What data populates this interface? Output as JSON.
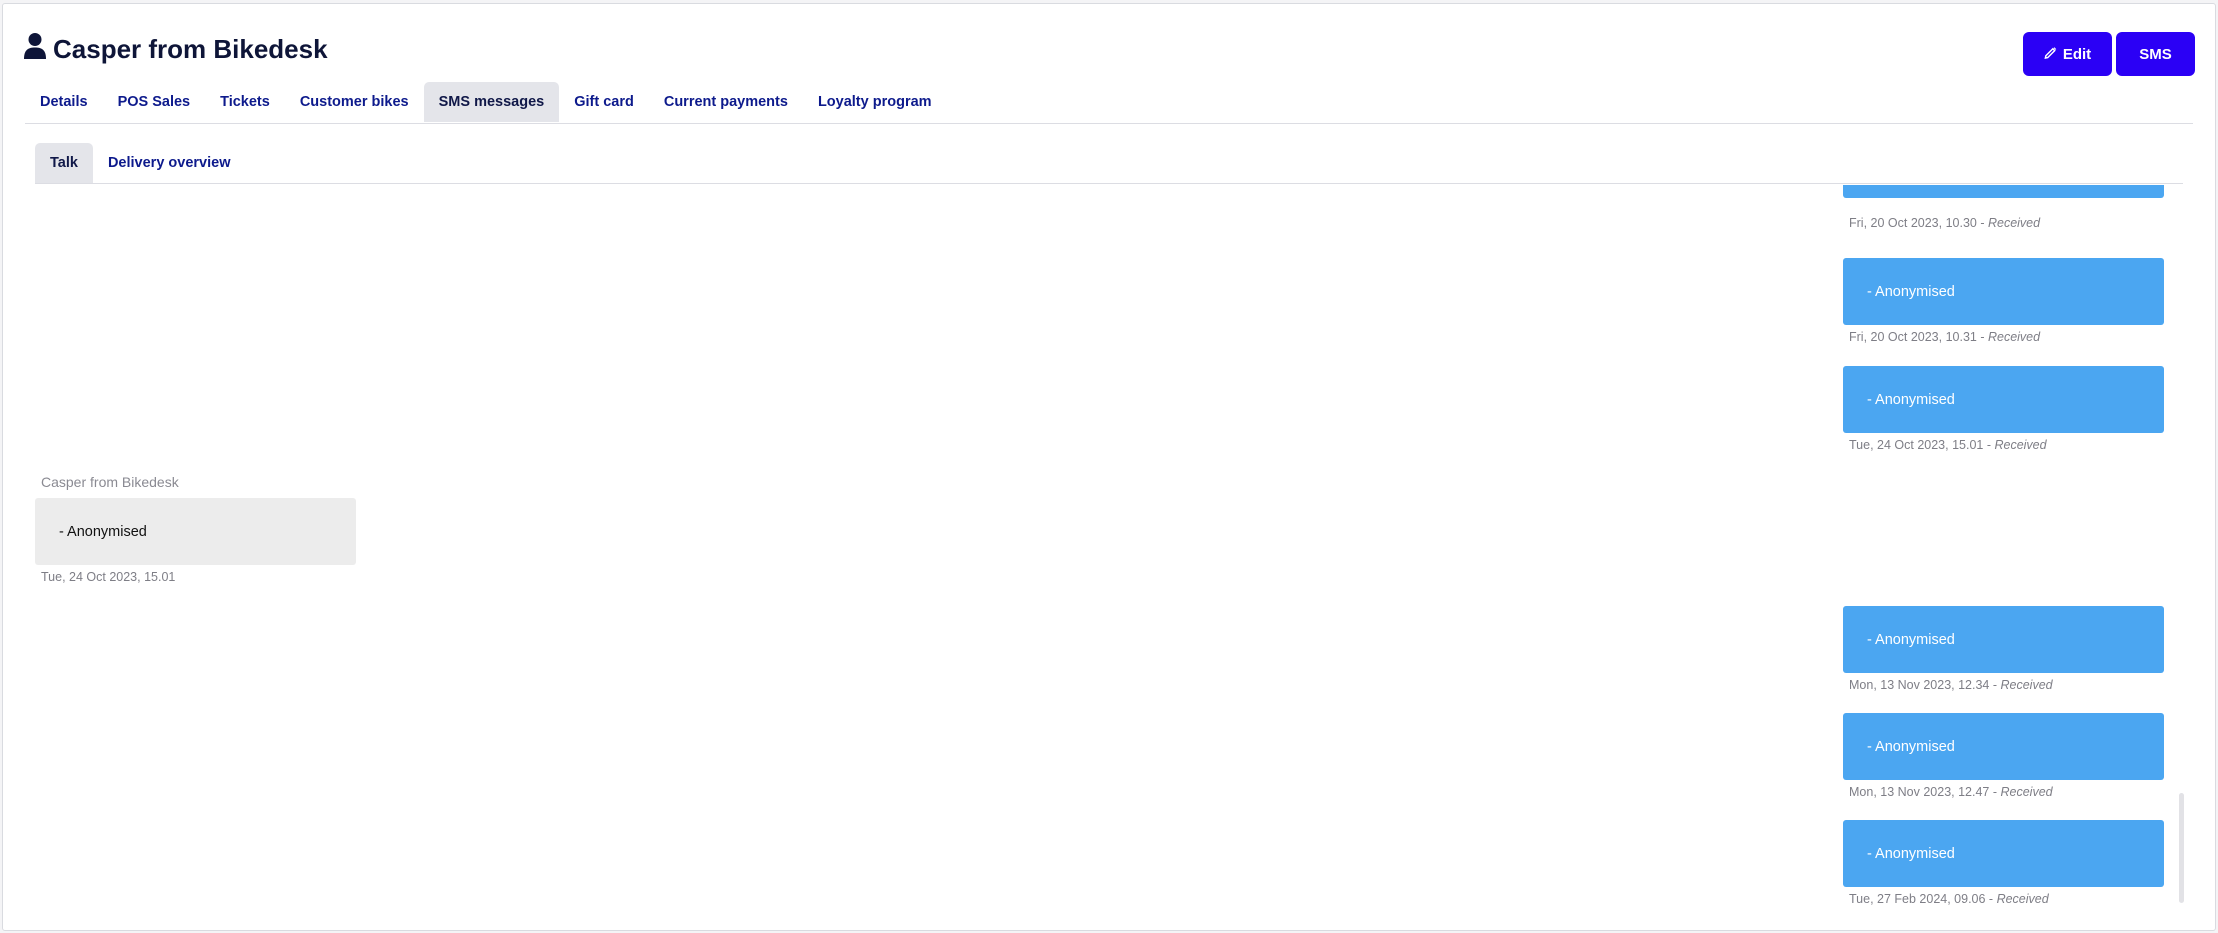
{
  "customer": {
    "name": "Casper from Bikedesk",
    "icon": "user-icon"
  },
  "actions": {
    "edit_label": "Edit",
    "sms_label": "SMS"
  },
  "tabs": [
    {
      "label": "Details"
    },
    {
      "label": "POS Sales"
    },
    {
      "label": "Tickets"
    },
    {
      "label": "Customer bikes"
    },
    {
      "label": "SMS messages",
      "active": true
    },
    {
      "label": "Gift card"
    },
    {
      "label": "Current payments"
    },
    {
      "label": "Loyalty program"
    }
  ],
  "subtabs": [
    {
      "label": "Talk",
      "active": true
    },
    {
      "label": "Delivery overview"
    }
  ],
  "messages": [
    {
      "direction": "in",
      "text": "",
      "date": "Fri, 20 Oct 2023, 10.30",
      "status": "Received",
      "partial": true
    },
    {
      "direction": "in",
      "text": "- Anonymised",
      "date": "Fri, 20 Oct 2023, 10.31",
      "status": "Received"
    },
    {
      "direction": "in",
      "text": "- Anonymised",
      "date": "Tue, 24 Oct 2023, 15.01",
      "status": "Received"
    },
    {
      "direction": "out",
      "sender": "Casper from Bikedesk",
      "text": "- Anonymised",
      "date": "Tue, 24 Oct 2023, 15.01"
    },
    {
      "direction": "in",
      "text": "- Anonymised",
      "date": "Mon, 13 Nov 2023, 12.34",
      "status": "Received"
    },
    {
      "direction": "in",
      "text": "- Anonymised",
      "date": "Mon, 13 Nov 2023, 12.47",
      "status": "Received"
    },
    {
      "direction": "in",
      "text": "- Anonymised",
      "date": "Tue, 27 Feb 2024, 09.06",
      "status": "Received"
    }
  ],
  "colors": {
    "accent": "#2b00f5",
    "incoming_bubble": "#4ba6f1",
    "outgoing_bubble": "#ececec",
    "tab_text": "#0d1a8c"
  }
}
